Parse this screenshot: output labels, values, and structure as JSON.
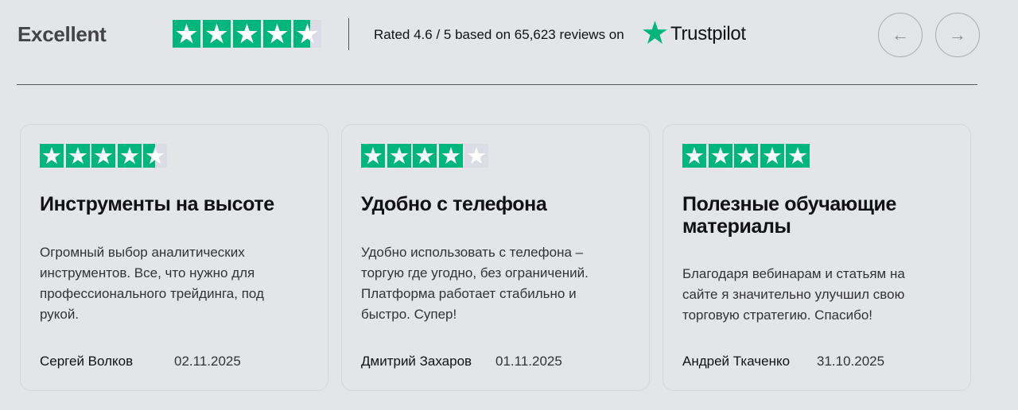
{
  "header": {
    "excellent_label": "Excellent",
    "rating": 4.6,
    "rating_text": "Rated 4.6 / 5 based on 65,623 reviews on",
    "brand": "Trustpilot",
    "brand_color": "#00b67a"
  },
  "nav": {
    "prev_icon": "arrow-left-icon",
    "next_icon": "arrow-right-icon",
    "prev_glyph": "←",
    "next_glyph": "→"
  },
  "reviews": [
    {
      "rating": 4.5,
      "title": "Инструменты на высоте",
      "text": "Огромный выбор аналитических инструментов. Все, что нужно для профессионального трейдинга, под рукой.",
      "author": "Сергей Волков",
      "date": "02.11.2025"
    },
    {
      "rating": 4,
      "title": "Удобно с телефона",
      "text": "Удобно использовать с телефона – торгую где угодно, без ограничений. Платформа работает стабильно и быстро. Супер!",
      "author": "Дмитрий Захаров",
      "date": "01.11.2025"
    },
    {
      "rating": 5,
      "title": "Полезные обучающие материалы",
      "text": "Благодаря вебинарам и статьям на сайте я значительно улучшил свою торговую стратегию. Спасибо!",
      "author": "Андрей Ткаченко",
      "date": "31.10.2025"
    }
  ]
}
